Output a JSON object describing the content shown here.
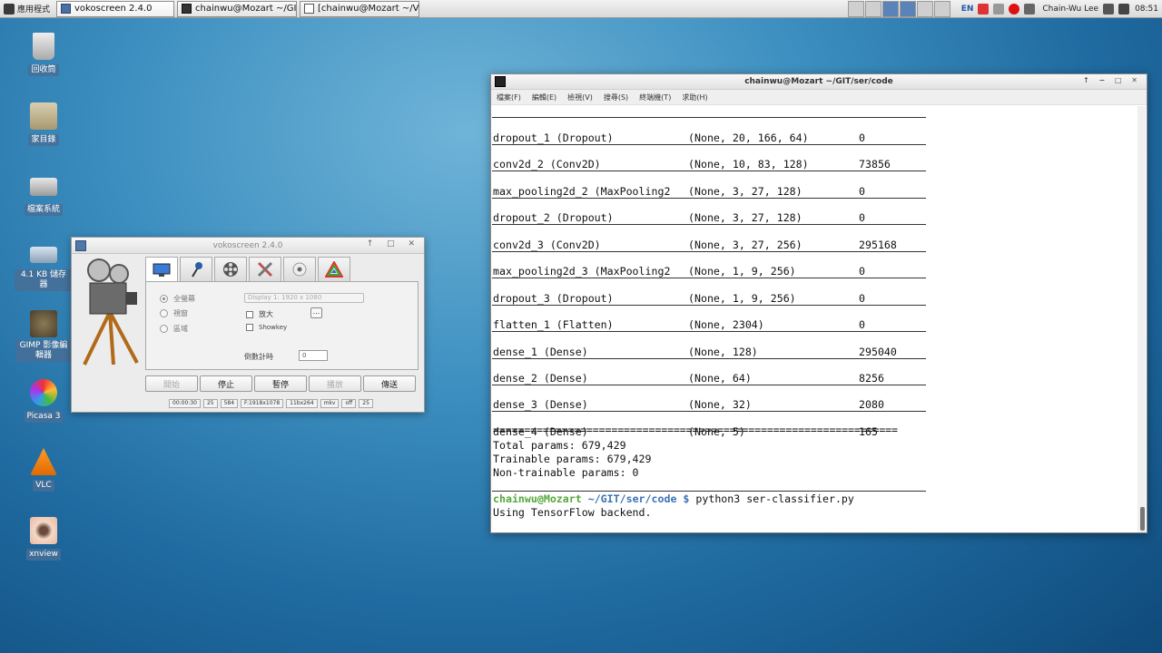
{
  "taskbar": {
    "app_menu": "應用程式",
    "tasks": [
      {
        "label": "vokoscreen 2.4.0"
      },
      {
        "label": "chainwu@Mozart ~/GIT/…"
      },
      {
        "label": "[chainwu@Mozart ~/Vid…"
      }
    ],
    "lang": "EN",
    "user": "Chain-Wu Lee",
    "clock": "08:51"
  },
  "desktop_icons": [
    {
      "label": "回收筒"
    },
    {
      "label": "家目錄"
    },
    {
      "label": "檔案系統"
    },
    {
      "label": "4.1 KB 儲存器"
    },
    {
      "label": "GIMP 影像編輯器"
    },
    {
      "label": "Picasa 3"
    },
    {
      "label": "VLC"
    },
    {
      "label": "xnview"
    }
  ],
  "vokoscreen": {
    "title": "vokoscreen 2.4.0",
    "radio_fullscreen": "全螢幕",
    "radio_window": "視窗",
    "radio_area": "區域",
    "display_combo": "Display 1: 1920 x 1080",
    "check_magnifier": "放大",
    "check_showkey": "Showkey",
    "dots_button": "...",
    "countdown_label": "倒數計時",
    "countdown_value": "0",
    "buttons": {
      "start": "開始",
      "stop": "停止",
      "pause": "暫停",
      "play": "播放",
      "send": "傳送"
    },
    "status": [
      "00:00:30",
      "25",
      "584",
      "F:1918x1078",
      "11bx264",
      "mkv",
      "off",
      "25"
    ]
  },
  "terminal": {
    "title": "chainwu@Mozart ~/GIT/ser/code",
    "menu": [
      "檔案(F)",
      "編輯(E)",
      "檢視(V)",
      "搜尋(S)",
      "終端機(T)",
      "求助(H)"
    ],
    "layers": [
      {
        "name": "dropout_1 (Dropout)",
        "shape": "(None, 20, 166, 64)",
        "params": "0"
      },
      {
        "name": "conv2d_2 (Conv2D)",
        "shape": "(None, 10, 83, 128)",
        "params": "73856"
      },
      {
        "name": "max_pooling2d_2 (MaxPooling2",
        "shape": "(None, 3, 27, 128)",
        "params": "0"
      },
      {
        "name": "dropout_2 (Dropout)",
        "shape": "(None, 3, 27, 128)",
        "params": "0"
      },
      {
        "name": "conv2d_3 (Conv2D)",
        "shape": "(None, 3, 27, 256)",
        "params": "295168"
      },
      {
        "name": "max_pooling2d_3 (MaxPooling2",
        "shape": "(None, 1, 9, 256)",
        "params": "0"
      },
      {
        "name": "dropout_3 (Dropout)",
        "shape": "(None, 1, 9, 256)",
        "params": "0"
      },
      {
        "name": "flatten_1 (Flatten)",
        "shape": "(None, 2304)",
        "params": "0"
      },
      {
        "name": "dense_1 (Dense)",
        "shape": "(None, 128)",
        "params": "295040"
      },
      {
        "name": "dense_2 (Dense)",
        "shape": "(None, 64)",
        "params": "8256"
      },
      {
        "name": "dense_3 (Dense)",
        "shape": "(None, 32)",
        "params": "2080"
      },
      {
        "name": "dense_4 (Dense)",
        "shape": "(None, 5)",
        "params": "165"
      }
    ],
    "double_rule": "=================================================================",
    "total": "Total params: 679,429",
    "trainable": "Trainable params: 679,429",
    "non_trainable": "Non-trainable params: 0",
    "prompt_user": "chainwu@Mozart",
    "prompt_path": "~/GIT/ser/code $",
    "command": "python3 ser-classifier.py",
    "output": "Using TensorFlow backend."
  }
}
